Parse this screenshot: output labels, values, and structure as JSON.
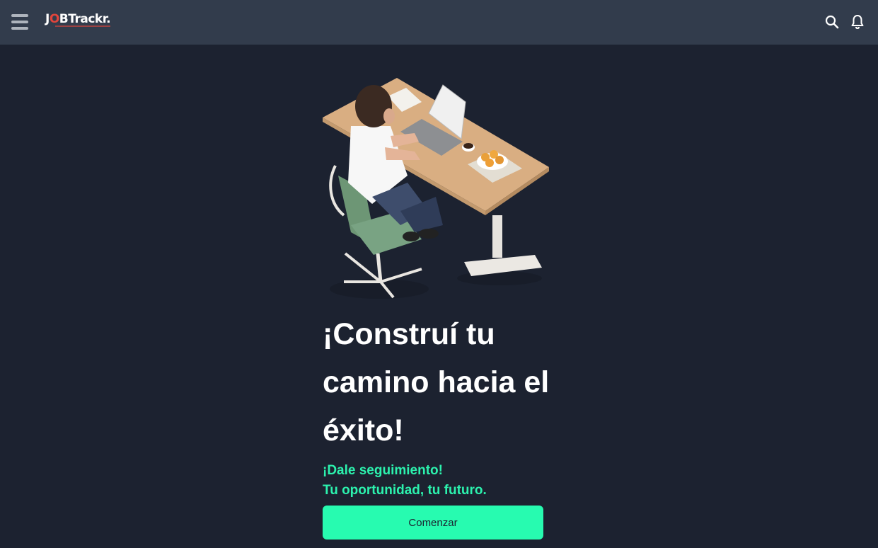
{
  "header": {
    "menu_icon": "hamburger-menu-icon",
    "logo": {
      "text_prefix": "J",
      "text_pin": "O",
      "text_suffix": "BTrackr."
    },
    "search_icon": "search-icon",
    "bell_icon": "bell-icon"
  },
  "hero": {
    "image": "person-at-desk-illustration",
    "title": "¡Construí tu camino hacia el éxito!",
    "subtitle_line1": "¡Dale seguimiento!",
    "subtitle_line2": "Tu oportunidad, tu futuro.",
    "cta_label": "Comenzar"
  },
  "colors": {
    "background": "#1c2230",
    "topbar": "#323c4c",
    "accent": "#27fbb0",
    "subtitle": "#2cf2ae",
    "logo_red": "#e2453c"
  }
}
